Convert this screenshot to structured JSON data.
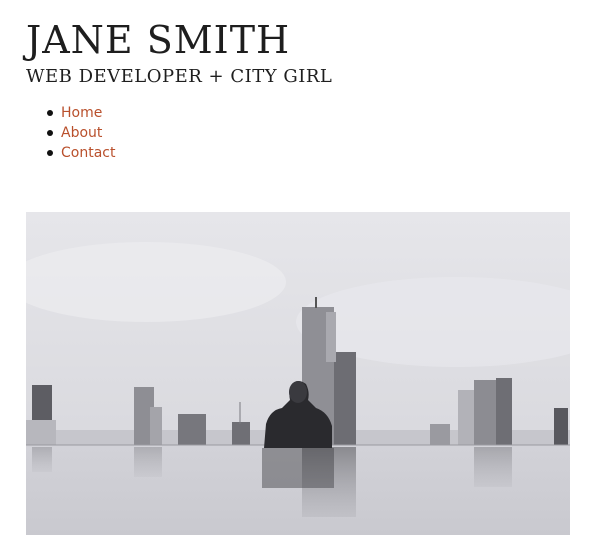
{
  "header": {
    "title": "JANE SMITH",
    "tagline": "WEB DEVELOPER + CITY GIRL"
  },
  "nav": {
    "items": [
      {
        "label": "Home"
      },
      {
        "label": "About"
      },
      {
        "label": "Contact"
      }
    ]
  },
  "colors": {
    "link": "#b9502c",
    "text": "#1e1e1e",
    "background": "#ffffff"
  }
}
